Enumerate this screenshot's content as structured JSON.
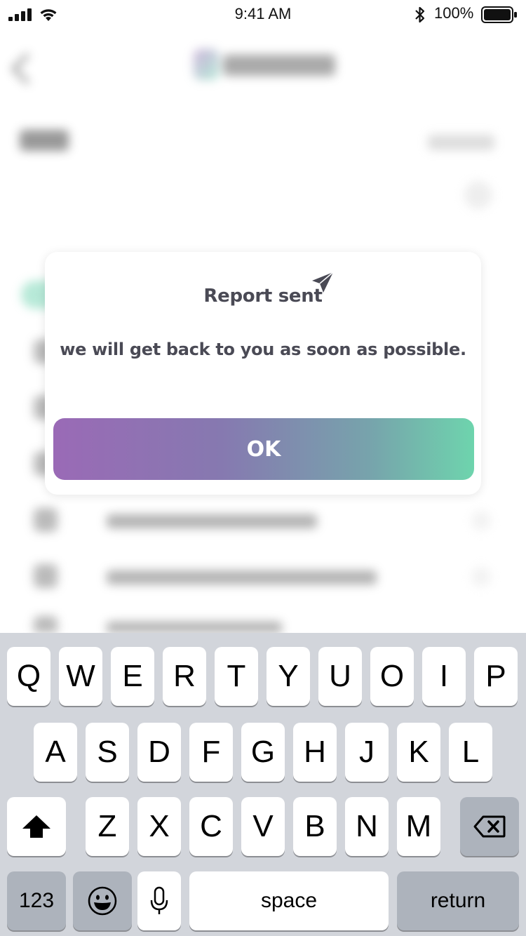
{
  "status_bar": {
    "time": "9:41 AM",
    "battery_percent": "100%",
    "signal_bars": 4,
    "wifi": true,
    "bluetooth": true,
    "battery_level": 1.0
  },
  "dialog": {
    "title": "Report sent",
    "message": "we will get back to you as soon as possible.",
    "ok_label": "OK",
    "title_icon": "paper-plane-icon"
  },
  "colors": {
    "text": "#4a4a55",
    "gradient_start": "#9a6ab6",
    "gradient_end": "#6ed4ad",
    "keyboard_bg": "#d2d5db",
    "key_dark": "#adb3bc"
  },
  "keyboard": {
    "row1": [
      "Q",
      "W",
      "E",
      "R",
      "T",
      "Y",
      "U",
      "O",
      "I",
      "P"
    ],
    "row2": [
      "A",
      "S",
      "D",
      "F",
      "G",
      "H",
      "J",
      "K",
      "L"
    ],
    "row3": [
      "Z",
      "X",
      "C",
      "V",
      "B",
      "N",
      "M"
    ],
    "numbers_label": "123",
    "space_label": "space",
    "return_label": "return",
    "shift_icon": "shift-icon",
    "delete_icon": "backspace-icon",
    "emoji_icon": "emoji-icon",
    "mic_icon": "microphone-icon"
  }
}
